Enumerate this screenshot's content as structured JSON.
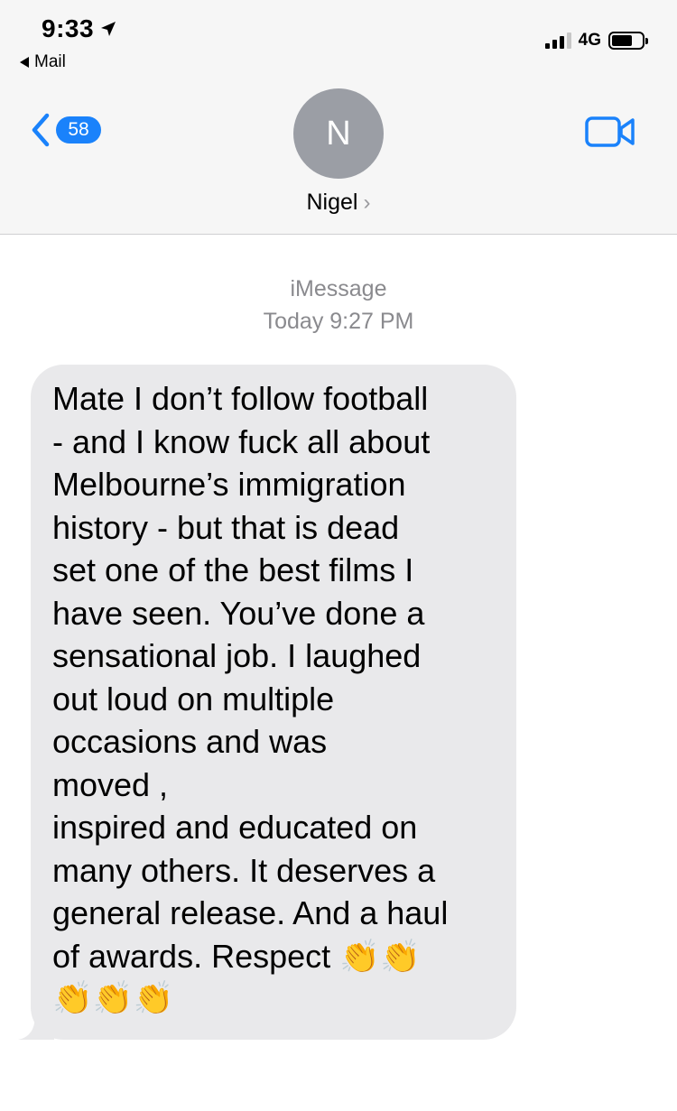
{
  "status_bar": {
    "time": "9:33",
    "back_app_label": "Mail",
    "network": "4G",
    "signal_bars": 3,
    "battery_level": 0.7
  },
  "nav": {
    "unread_count": "58",
    "avatar_initial": "N",
    "contact_name": "Nigel"
  },
  "conversation": {
    "service_label": "iMessage",
    "timestamp_label": "Today 9:27 PM",
    "message_lines": [
      "Mate I don’t follow football",
      "- and I know fuck all about",
      "Melbourne’s immigration",
      "history - but that is dead",
      "set one of the best films I",
      "have seen. You’ve done a",
      "sensational job. I laughed",
      "out loud on multiple",
      "occasions and was",
      "moved ,",
      "inspired and educated on",
      "many others. It deserves a",
      "general release. And a haul",
      "of awards. Respect 👏👏",
      "👏👏👏"
    ]
  },
  "colors": {
    "accent": "#1a82fb",
    "bubble_gray": "#e9e9eb",
    "avatar_gray": "#9b9ea5",
    "meta_gray": "#8a8a8e"
  }
}
